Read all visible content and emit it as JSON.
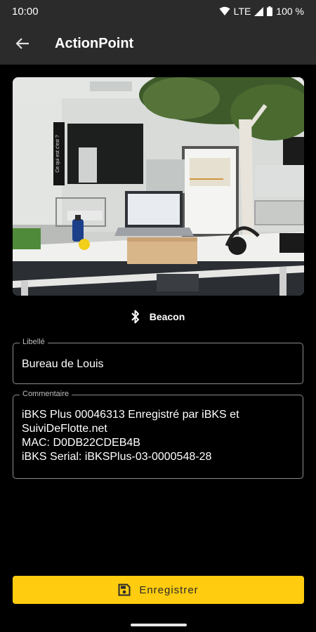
{
  "status": {
    "time": "10:00",
    "network": "LTE",
    "battery": "100 %"
  },
  "app_bar": {
    "title": "ActionPoint"
  },
  "beacon": {
    "label": "Beacon"
  },
  "fields": {
    "libelle": {
      "label": "Libellé",
      "value": "Bureau de Louis"
    },
    "commentaire": {
      "label": "Commentaire",
      "value": "iBKS Plus 00046313 Enregistré par iBKS et\nSuiviDeFlotte.net\nMAC: D0DB22CDEB4B\niBKS Serial: iBKSPlus-03-0000548-28"
    }
  },
  "photo_text": {
    "poster": "Ce qui est c'est ?"
  },
  "actions": {
    "save_label": "Enregistrer"
  },
  "colors": {
    "accent": "#ffcc0f",
    "bar": "#2b2b2b",
    "background": "#000000"
  }
}
